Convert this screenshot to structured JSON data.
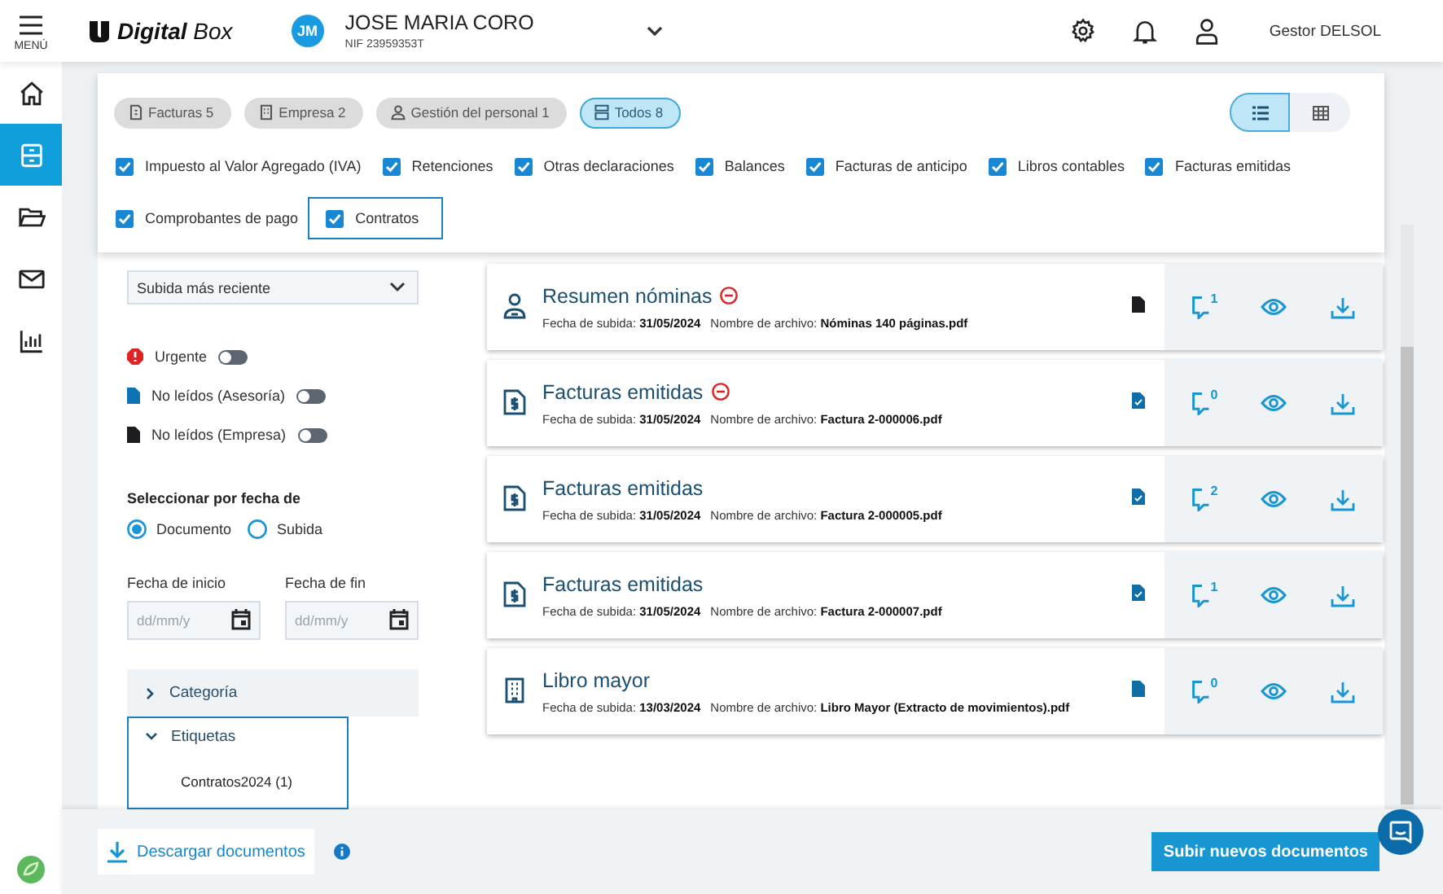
{
  "header": {
    "menu_label": "MENÚ",
    "logo": "**Digital** Box",
    "avatar": "JM",
    "company": "JOSE MARIA CORO",
    "nif": "NIF 23959353T",
    "user": "Gestor DELSOL"
  },
  "nav": [
    {
      "kind": "home",
      "selected": false
    },
    {
      "kind": "archive",
      "selected": true
    },
    {
      "kind": "folder",
      "selected": false
    },
    {
      "kind": "mail",
      "selected": false
    },
    {
      "kind": "chart",
      "selected": false
    }
  ],
  "chips": [
    {
      "kind": "invoice",
      "label": "Facturas 5",
      "selected": false
    },
    {
      "kind": "building",
      "label": "Empresa 2",
      "selected": false
    },
    {
      "kind": "person",
      "label": "Gestión del personal 1",
      "selected": false
    },
    {
      "kind": "stack",
      "label": "Todos 8",
      "selected": true
    }
  ],
  "view_toggle": [
    {
      "kind": "list",
      "selected": true
    },
    {
      "kind": "grid",
      "selected": false
    }
  ],
  "categories": [
    {
      "label": "Impuesto al Valor Agregado (IVA)",
      "checked": true,
      "focused": false
    },
    {
      "label": "Retenciones",
      "checked": true,
      "focused": false
    },
    {
      "label": "Otras declaraciones",
      "checked": true,
      "focused": false
    },
    {
      "label": "Balances",
      "checked": true,
      "focused": false
    },
    {
      "label": "Facturas de anticipo",
      "checked": true,
      "focused": false
    },
    {
      "label": "Libros contables",
      "checked": true,
      "focused": false
    },
    {
      "label": "Facturas emitidas",
      "checked": true,
      "focused": false
    },
    {
      "label": "Comprobantes de pago",
      "checked": true,
      "focused": false
    },
    {
      "label": "Contratos",
      "checked": true,
      "focused": true
    }
  ],
  "sort": {
    "value": "Subida más reciente"
  },
  "toggles": [
    {
      "kind": "urgent",
      "label": "Urgente",
      "on": false
    },
    {
      "kind": "advisor",
      "label": "No leídos (Asesoría)",
      "on": false
    },
    {
      "kind": "company",
      "label": "No leídos (Empresa)",
      "on": false
    }
  ],
  "date_filter": {
    "title": "Seleccionar por fecha de",
    "options": [
      {
        "label": "Documento",
        "selected": true
      },
      {
        "label": "Subida",
        "selected": false
      }
    ],
    "fields": [
      {
        "label": "Fecha de inicio",
        "placeholder": "dd/mm/y"
      },
      {
        "label": "Fecha de fin",
        "placeholder": "dd/mm/y"
      }
    ]
  },
  "accordions": [
    {
      "label": "Categoría",
      "expanded": false,
      "focused": false
    },
    {
      "label": "Etiquetas",
      "expanded": true,
      "focused": true,
      "children": [
        {
          "label": "Contratos2024 (1)"
        }
      ]
    }
  ],
  "documents": [
    {
      "kind": "payroll",
      "title": "Resumen nóminas",
      "urgent": true,
      "date_label": "Fecha de subida:",
      "date": "31/05/2024",
      "file_label": "Nombre de archivo:",
      "file": "Nóminas 140 páginas.pdf",
      "read": false,
      "signed": false,
      "comments": "1"
    },
    {
      "kind": "invoice",
      "title": "Facturas emitidas",
      "urgent": true,
      "date_label": "Fecha de subida:",
      "date": "31/05/2024",
      "file_label": "Nombre de archivo:",
      "file": "Factura 2-000006.pdf",
      "read": true,
      "signed": true,
      "comments": "0"
    },
    {
      "kind": "invoice",
      "title": "Facturas emitidas",
      "urgent": false,
      "date_label": "Fecha de subida:",
      "date": "31/05/2024",
      "file_label": "Nombre de archivo:",
      "file": "Factura 2-000005.pdf",
      "read": true,
      "signed": true,
      "comments": "2"
    },
    {
      "kind": "invoice",
      "title": "Facturas emitidas",
      "urgent": false,
      "date_label": "Fecha de subida:",
      "date": "31/05/2024",
      "file_label": "Nombre de archivo:",
      "file": "Factura 2-000007.pdf",
      "read": true,
      "signed": true,
      "comments": "1"
    },
    {
      "kind": "building",
      "title": "Libro mayor",
      "urgent": false,
      "date_label": "Fecha de subida:",
      "date": "13/03/2024",
      "file_label": "Nombre de archivo:",
      "file": "Libro Mayor (Extracto de movimientos).pdf",
      "read": true,
      "signed": false,
      "comments": "0"
    }
  ],
  "footer": {
    "download": "Descargar documentos",
    "upload": "Subir nuevos documentos"
  }
}
